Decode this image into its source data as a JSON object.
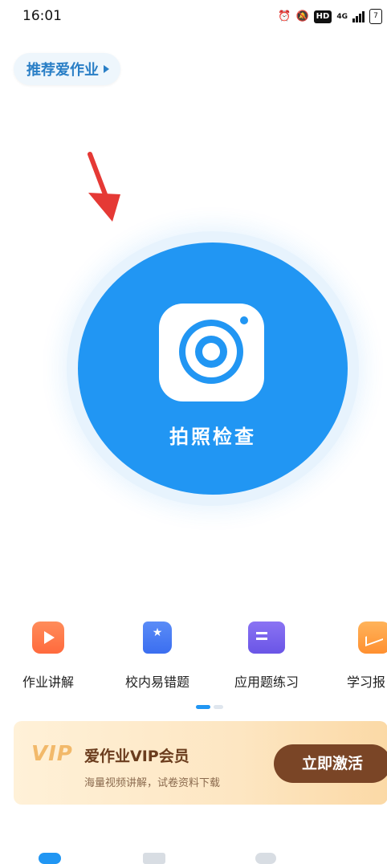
{
  "status_bar": {
    "time": "16:01",
    "icons": [
      "alarm-icon",
      "mute-icon",
      "hd-icon",
      "4g-signal-icon",
      "battery-icon"
    ],
    "hd_label": "HD",
    "net_label": "4G",
    "battery_label": "7"
  },
  "recommend": {
    "label": "推荐爱作业"
  },
  "camera_button": {
    "label": "拍照检查"
  },
  "features": [
    {
      "label": "作业讲解",
      "icon": "video-play-icon"
    },
    {
      "label": "校内易错题",
      "icon": "star-book-icon"
    },
    {
      "label": "应用题练习",
      "icon": "open-book-icon"
    },
    {
      "label": "学习报",
      "icon": "report-chart-icon"
    }
  ],
  "pager": {
    "active_index": 0,
    "count": 2
  },
  "vip": {
    "logo": "VIP",
    "title": "爱作业VIP会员",
    "subtitle": "海量视频讲解，试卷资料下载",
    "cta": "立即激活"
  },
  "colors": {
    "primary": "#2196f3",
    "arrow": "#e53935",
    "vip_button": "#7a4526",
    "vip_title": "#6b3d1e"
  }
}
